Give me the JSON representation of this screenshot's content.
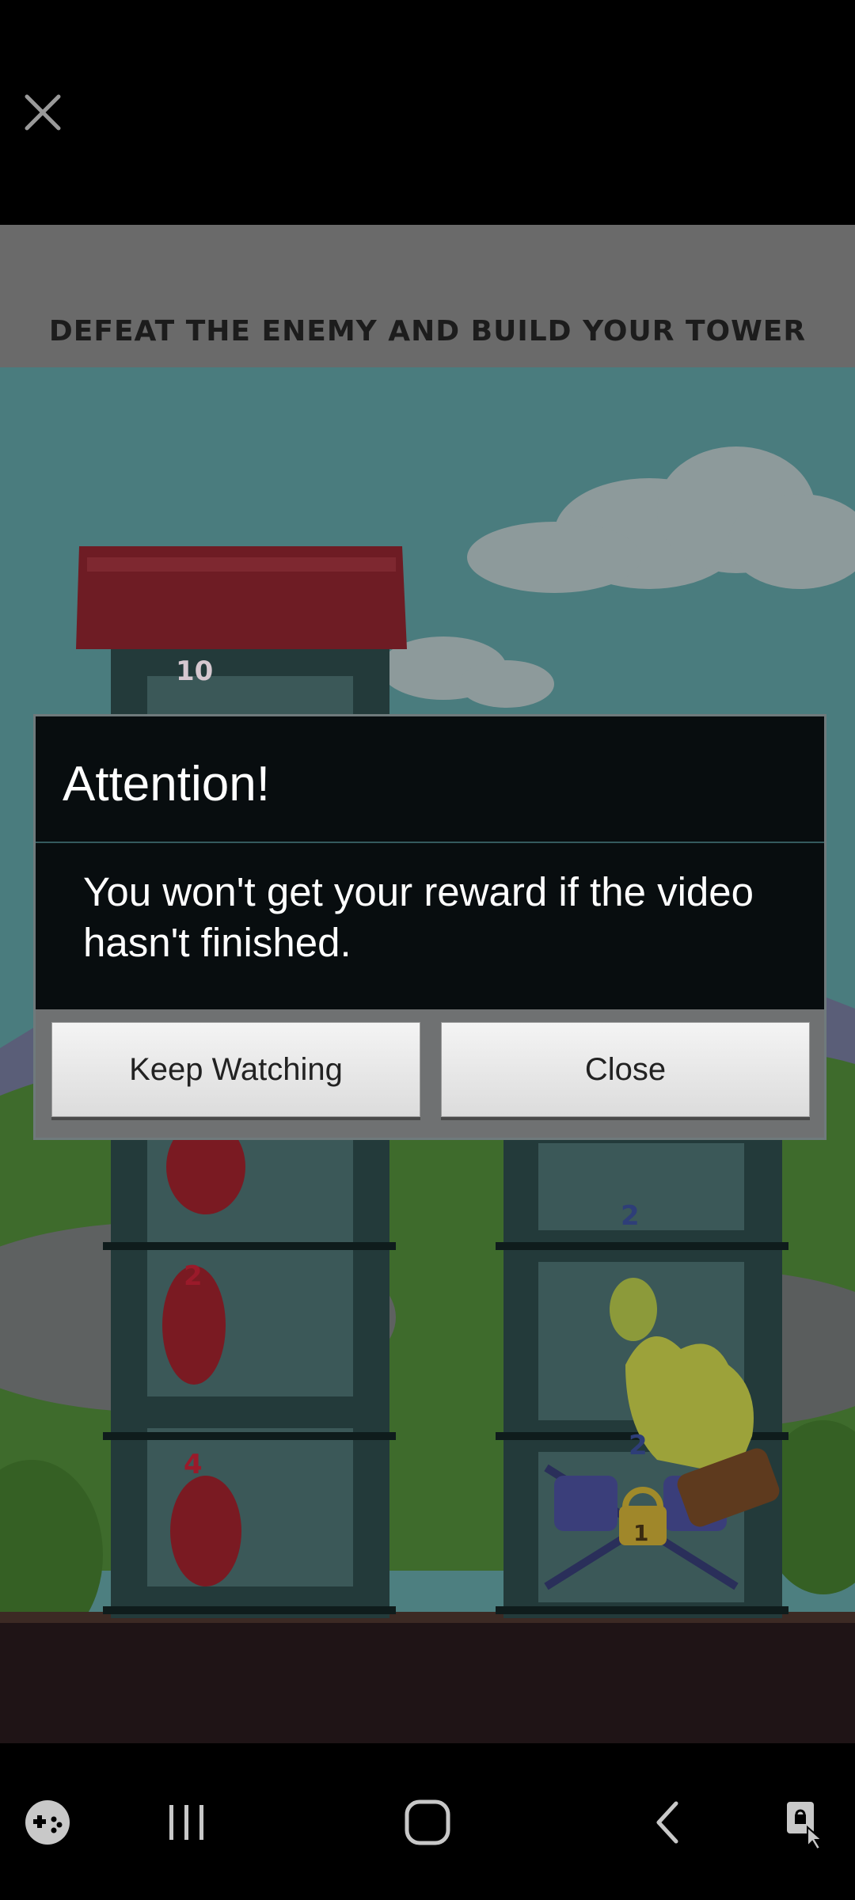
{
  "ad": {
    "headline": "DEFEAT THE ENEMY AND BUILD YOUR TOWER",
    "towers": {
      "left_labels": [
        "10",
        "2",
        "4"
      ],
      "right_labels": [
        "2",
        "2"
      ],
      "lock_label": "1"
    }
  },
  "dialog": {
    "title": "Attention!",
    "message": "You won't get your reward if the video hasn't finished.",
    "keep_watching_label": "Keep Watching",
    "close_label": "Close"
  },
  "icons": {
    "close": "close-icon",
    "game_tools": "game-tools-icon",
    "recents": "recent-apps-icon",
    "home": "home-icon",
    "back": "back-icon",
    "lock_screen": "screen-lock-icon"
  }
}
